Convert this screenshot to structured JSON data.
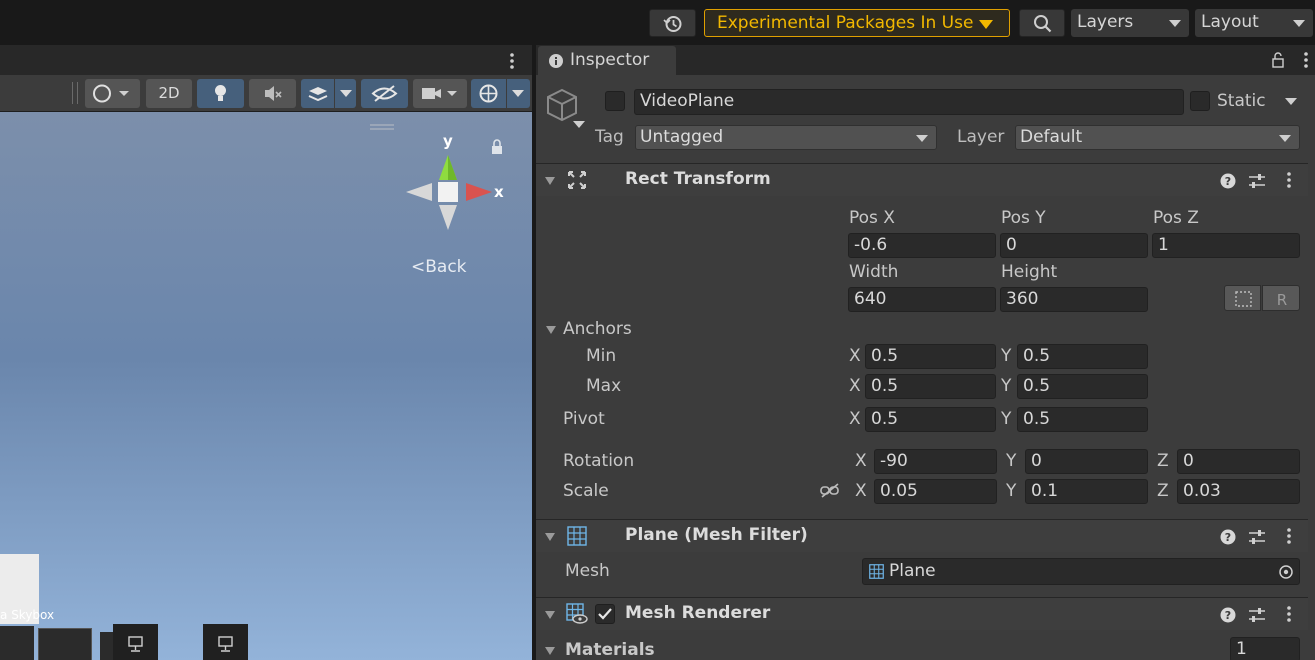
{
  "toolbar": {
    "experimental_label": "Experimental Packages In Use",
    "layers_label": "Layers",
    "layout_label": "Layout"
  },
  "scene": {
    "toolbar": {
      "mode_2d_label": "2D"
    },
    "gizmo": {
      "y_label": "y",
      "x_label": "x",
      "back_label": "Back"
    },
    "bottom_labels": {
      "skybox": "Skybox",
      "cut_label": "a"
    }
  },
  "inspector": {
    "tab_label": "Inspector",
    "object": {
      "name": "VideoPlane",
      "static_label": "Static",
      "tag_label": "Tag",
      "tag_value": "Untagged",
      "layer_label": "Layer",
      "layer_value": "Default"
    },
    "rect_transform": {
      "title": "Rect Transform",
      "pos_x_label": "Pos X",
      "pos_y_label": "Pos Y",
      "pos_z_label": "Pos Z",
      "pos_x": "-0.6",
      "pos_y": "0",
      "pos_z": "1",
      "width_label": "Width",
      "height_label": "Height",
      "width": "640",
      "height": "360",
      "anchors_label": "Anchors",
      "min_label": "Min",
      "max_label": "Max",
      "min_x": "0.5",
      "min_y": "0.5",
      "max_x": "0.5",
      "max_y": "0.5",
      "pivot_label": "Pivot",
      "pivot_x": "0.5",
      "pivot_y": "0.5",
      "rotation_label": "Rotation",
      "rot_x": "-90",
      "rot_y": "0",
      "rot_z": "0",
      "scale_label": "Scale",
      "scale_x": "0.05",
      "scale_y": "0.1",
      "scale_z": "0.03",
      "x": "X",
      "y": "Y",
      "z": "Z"
    },
    "mesh_filter": {
      "title": "Plane (Mesh Filter)",
      "mesh_label": "Mesh",
      "mesh_value": "Plane"
    },
    "mesh_renderer": {
      "title": "Mesh Renderer",
      "materials_label": "Materials",
      "materials_count": "1"
    }
  },
  "colors": {
    "accent_warning": "#f2b800",
    "active_toggle": "#46607c",
    "gizmo_y": "#7ed321",
    "gizmo_x": "#d9534f"
  }
}
